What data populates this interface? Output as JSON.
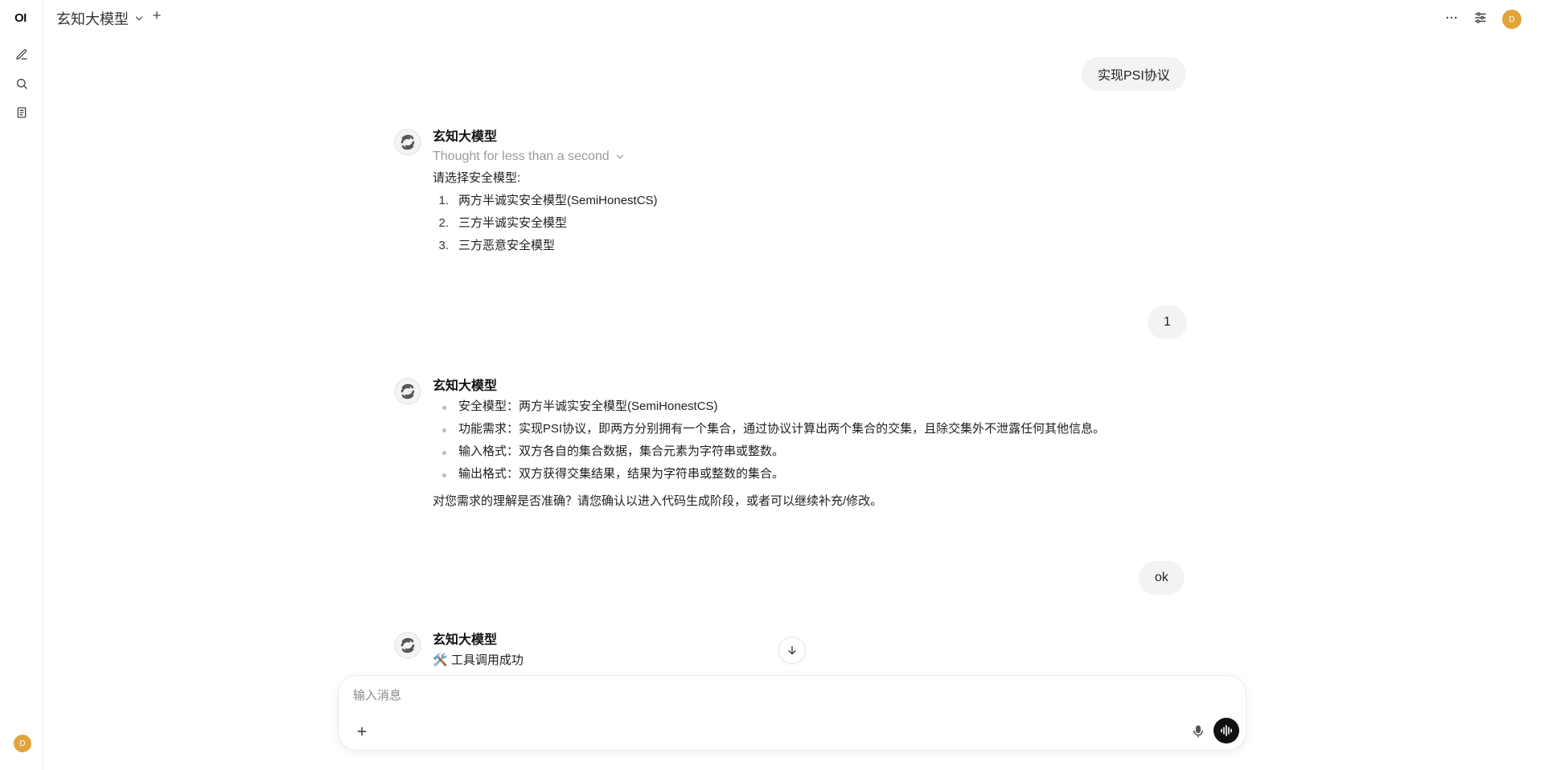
{
  "rail": {
    "logo": "OI",
    "avatar_initial": "D"
  },
  "topbar": {
    "model_name": "玄知大模型",
    "avatar_initial": "D"
  },
  "messages": {
    "user1": "实现PSI协议",
    "assistant1": {
      "name": "玄知大模型",
      "thought": "Thought for less than a second",
      "intro": "请选择安全模型:",
      "options": [
        {
          "num": "1.",
          "text": "两方半诚实安全模型(SemiHonestCS)"
        },
        {
          "num": "2.",
          "text": "三方半诚实安全模型"
        },
        {
          "num": "3.",
          "text": "三方恶意安全模型"
        }
      ]
    },
    "user2": "1",
    "assistant2": {
      "name": "玄知大模型",
      "bullets": [
        "安全模型：两方半诚实安全模型(SemiHonestCS)",
        "功能需求：实现PSI协议，即两方分别拥有一个集合，通过协议计算出两个集合的交集，且除交集外不泄露任何其他信息。",
        "输入格式：双方各自的集合数据，集合元素为字符串或整数。",
        "输出格式：双方获得交集结果，结果为字符串或整数的集合。"
      ],
      "closing": "对您需求的理解是否准确？请您确认以进入代码生成阶段，或者可以继续补充/修改。"
    },
    "user3": "ok",
    "assistant3": {
      "name": "玄知大模型",
      "tool_status": "🛠️ 工具调用成功"
    }
  },
  "composer": {
    "placeholder": "输入消息"
  }
}
